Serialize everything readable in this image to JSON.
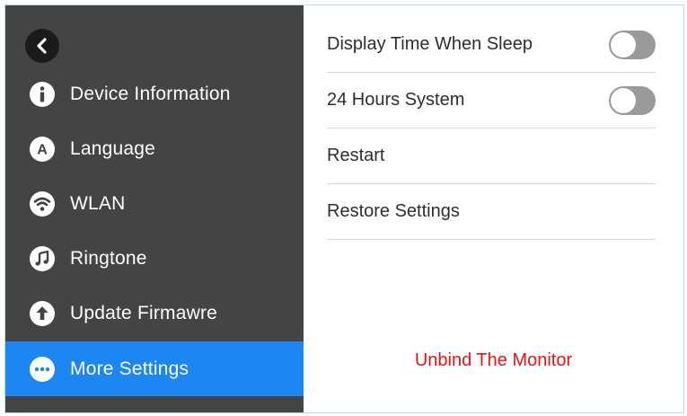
{
  "sidebar": {
    "back_icon": "chevron-left-icon",
    "items": [
      {
        "label": "Device Information",
        "icon": "info-icon",
        "active": false
      },
      {
        "label": "Language",
        "icon": "language-icon",
        "active": false
      },
      {
        "label": "WLAN",
        "icon": "wifi-icon",
        "active": false
      },
      {
        "label": "Ringtone",
        "icon": "music-note-icon",
        "active": false
      },
      {
        "label": "Update Firmawre",
        "icon": "upload-arrow-icon",
        "active": false
      },
      {
        "label": "More Settings",
        "icon": "more-dots-icon",
        "active": true
      }
    ]
  },
  "main": {
    "settings": [
      {
        "label": "Display Time When Sleep",
        "toggle": false
      },
      {
        "label": "24 Hours System",
        "toggle": false
      },
      {
        "label": "Restart"
      },
      {
        "label": "Restore Settings"
      }
    ],
    "unbind_label": "Unbind The Monitor"
  },
  "colors": {
    "sidebar_bg": "#444444",
    "active_item": "#1c86f2",
    "toggle_off": "#9a9a9a",
    "danger_text": "#e81313"
  }
}
